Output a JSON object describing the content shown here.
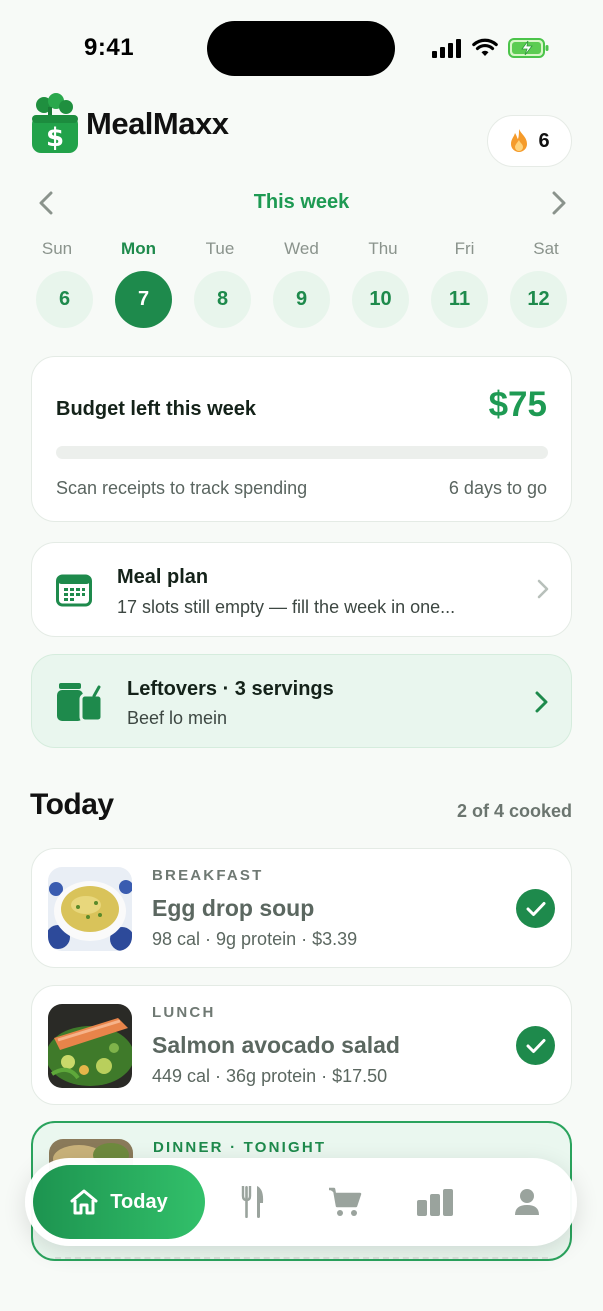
{
  "status_bar": {
    "time": "9:41"
  },
  "app": {
    "name": "MealMaxx",
    "streak_count": "6"
  },
  "week": {
    "title": "This week",
    "days": [
      {
        "label": "Sun",
        "date": "6",
        "active": false
      },
      {
        "label": "Mon",
        "date": "7",
        "active": true
      },
      {
        "label": "Tue",
        "date": "8",
        "active": false
      },
      {
        "label": "Wed",
        "date": "9",
        "active": false
      },
      {
        "label": "Thu",
        "date": "10",
        "active": false
      },
      {
        "label": "Fri",
        "date": "11",
        "active": false
      },
      {
        "label": "Sat",
        "date": "12",
        "active": false
      }
    ]
  },
  "budget": {
    "title": "Budget left this week",
    "amount": "$75",
    "spent_fraction": 0,
    "hint": "Scan receipts to track spending",
    "days_left": "6 days to go"
  },
  "meal_plan": {
    "title": "Meal plan",
    "subtitle": "17 slots still empty — fill the week in one..."
  },
  "leftovers": {
    "title": "Leftovers · 3 servings",
    "subtitle": "Beef lo mein"
  },
  "today": {
    "title": "Today",
    "progress": "2 of 4 cooked",
    "meals": [
      {
        "type": "BREAKFAST",
        "name": "Egg drop soup",
        "meta": "98 cal · 9g protein · $3.39",
        "cooked": true
      },
      {
        "type": "LUNCH",
        "name": "Salmon avocado salad",
        "meta": "449 cal · 36g protein · $17.50",
        "cooked": true
      },
      {
        "type": "DINNER · TONIGHT",
        "name": "",
        "meta": "",
        "cooked": false
      }
    ]
  },
  "tab_bar": {
    "active_label": "Today",
    "tabs": [
      "home-icon",
      "fork-knife-icon",
      "cart-icon",
      "bar-chart-icon",
      "profile-icon"
    ]
  },
  "colors": {
    "accent": "#1e9a53",
    "accent_dark": "#1e8a4c",
    "tint": "#e8f5ec"
  }
}
